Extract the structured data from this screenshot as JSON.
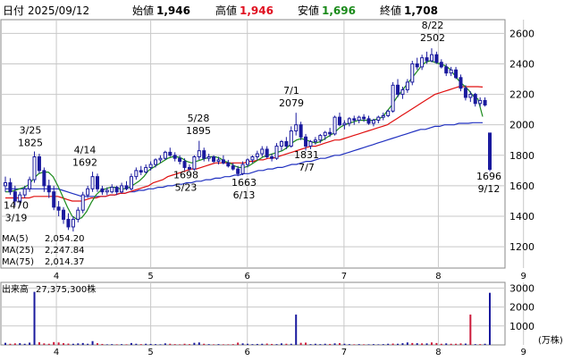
{
  "header": {
    "date_label": "日付",
    "date_value": "2025/09/12",
    "open_label": "始値",
    "open_value": "1,946",
    "high_label": "高値",
    "high_value": "1,946",
    "low_label": "安値",
    "low_value": "1,696",
    "close_label": "終値",
    "close_value": "1,708"
  },
  "colors": {
    "up_candle": "#1a1a9e",
    "ma5": "#1a8a1a",
    "ma25": "#e01010",
    "ma75": "#2030c0",
    "volume_up": "#1a1a9e",
    "volume_down": "#cc1a3a",
    "grid": "#c8c8c8",
    "label_red": "#e01020",
    "label_green": "#1a8a1a"
  },
  "chart_data": [
    {
      "type": "candlestick",
      "x_ticks": [
        "4",
        "5",
        "6",
        "7",
        "8",
        "9"
      ],
      "y_ticks": [
        "1200",
        "1400",
        "1600",
        "1800",
        "2000",
        "2200",
        "2400",
        "2600"
      ],
      "ylim": [
        1060,
        2690
      ],
      "grid": true,
      "legend": [
        {
          "name": "MA(5)",
          "value": "2,054.20"
        },
        {
          "name": "MA(25)",
          "value": "2,247.84"
        },
        {
          "name": "MA(75)",
          "value": "2,014.37"
        }
      ],
      "annotations": [
        {
          "date": "3/19",
          "value": "1470",
          "kind": "low"
        },
        {
          "date": "3/25",
          "value": "1825",
          "kind": "high"
        },
        {
          "date": "4/14",
          "value": "1692",
          "kind": "high"
        },
        {
          "date": "5/23",
          "value": "1698",
          "kind": "low"
        },
        {
          "date": "5/28",
          "value": "1895",
          "kind": "high"
        },
        {
          "date": "6/13",
          "value": "1663",
          "kind": "low"
        },
        {
          "date": "7/1",
          "value": "2079",
          "kind": "high"
        },
        {
          "date": "7/7",
          "value": "1831",
          "kind": "low"
        },
        {
          "date": "8/22",
          "value": "2502",
          "kind": "high"
        },
        {
          "date": "9/12",
          "value": "1696",
          "kind": "low"
        }
      ],
      "candles": [
        {
          "o": 1600,
          "h": 1660,
          "l": 1560,
          "c": 1620
        },
        {
          "o": 1620,
          "h": 1650,
          "l": 1540,
          "c": 1560
        },
        {
          "o": 1560,
          "h": 1600,
          "l": 1470,
          "c": 1500
        },
        {
          "o": 1500,
          "h": 1560,
          "l": 1470,
          "c": 1540
        },
        {
          "o": 1540,
          "h": 1600,
          "l": 1520,
          "c": 1580
        },
        {
          "o": 1580,
          "h": 1660,
          "l": 1560,
          "c": 1640
        },
        {
          "o": 1640,
          "h": 1825,
          "l": 1620,
          "c": 1790
        },
        {
          "o": 1790,
          "h": 1810,
          "l": 1680,
          "c": 1700
        },
        {
          "o": 1700,
          "h": 1720,
          "l": 1560,
          "c": 1600
        },
        {
          "o": 1600,
          "h": 1640,
          "l": 1520,
          "c": 1560
        },
        {
          "o": 1560,
          "h": 1600,
          "l": 1440,
          "c": 1460
        },
        {
          "o": 1460,
          "h": 1500,
          "l": 1400,
          "c": 1440
        },
        {
          "o": 1440,
          "h": 1460,
          "l": 1350,
          "c": 1380
        },
        {
          "o": 1380,
          "h": 1420,
          "l": 1310,
          "c": 1330
        },
        {
          "o": 1330,
          "h": 1400,
          "l": 1300,
          "c": 1380
        },
        {
          "o": 1380,
          "h": 1460,
          "l": 1360,
          "c": 1440
        },
        {
          "o": 1440,
          "h": 1560,
          "l": 1420,
          "c": 1540
        },
        {
          "o": 1540,
          "h": 1600,
          "l": 1520,
          "c": 1580
        },
        {
          "o": 1580,
          "h": 1692,
          "l": 1560,
          "c": 1660
        },
        {
          "o": 1660,
          "h": 1680,
          "l": 1560,
          "c": 1580
        },
        {
          "o": 1580,
          "h": 1600,
          "l": 1540,
          "c": 1560
        },
        {
          "o": 1560,
          "h": 1590,
          "l": 1540,
          "c": 1570
        },
        {
          "o": 1560,
          "h": 1610,
          "l": 1550,
          "c": 1590
        },
        {
          "o": 1590,
          "h": 1600,
          "l": 1540,
          "c": 1560
        },
        {
          "o": 1560,
          "h": 1620,
          "l": 1550,
          "c": 1600
        },
        {
          "o": 1600,
          "h": 1630,
          "l": 1570,
          "c": 1580
        },
        {
          "o": 1580,
          "h": 1680,
          "l": 1570,
          "c": 1660
        },
        {
          "o": 1660,
          "h": 1720,
          "l": 1640,
          "c": 1700
        },
        {
          "o": 1700,
          "h": 1730,
          "l": 1670,
          "c": 1690
        },
        {
          "o": 1690,
          "h": 1740,
          "l": 1680,
          "c": 1720
        },
        {
          "o": 1720,
          "h": 1760,
          "l": 1700,
          "c": 1740
        },
        {
          "o": 1740,
          "h": 1780,
          "l": 1720,
          "c": 1770
        },
        {
          "o": 1770,
          "h": 1800,
          "l": 1750,
          "c": 1780
        },
        {
          "o": 1780,
          "h": 1830,
          "l": 1770,
          "c": 1820
        },
        {
          "o": 1820,
          "h": 1850,
          "l": 1790,
          "c": 1800
        },
        {
          "o": 1800,
          "h": 1820,
          "l": 1760,
          "c": 1780
        },
        {
          "o": 1780,
          "h": 1800,
          "l": 1740,
          "c": 1760
        },
        {
          "o": 1760,
          "h": 1780,
          "l": 1700,
          "c": 1720
        },
        {
          "o": 1720,
          "h": 1740,
          "l": 1698,
          "c": 1710
        },
        {
          "o": 1710,
          "h": 1800,
          "l": 1700,
          "c": 1790
        },
        {
          "o": 1790,
          "h": 1895,
          "l": 1770,
          "c": 1830
        },
        {
          "o": 1830,
          "h": 1850,
          "l": 1760,
          "c": 1780
        },
        {
          "o": 1780,
          "h": 1810,
          "l": 1760,
          "c": 1790
        },
        {
          "o": 1790,
          "h": 1800,
          "l": 1750,
          "c": 1760
        },
        {
          "o": 1760,
          "h": 1790,
          "l": 1740,
          "c": 1770
        },
        {
          "o": 1770,
          "h": 1800,
          "l": 1740,
          "c": 1750
        },
        {
          "o": 1750,
          "h": 1770,
          "l": 1720,
          "c": 1730
        },
        {
          "o": 1730,
          "h": 1750,
          "l": 1700,
          "c": 1710
        },
        {
          "o": 1710,
          "h": 1730,
          "l": 1663,
          "c": 1680
        },
        {
          "o": 1680,
          "h": 1760,
          "l": 1670,
          "c": 1740
        },
        {
          "o": 1740,
          "h": 1780,
          "l": 1720,
          "c": 1770
        },
        {
          "o": 1770,
          "h": 1800,
          "l": 1750,
          "c": 1790
        },
        {
          "o": 1790,
          "h": 1830,
          "l": 1770,
          "c": 1810
        },
        {
          "o": 1810,
          "h": 1860,
          "l": 1790,
          "c": 1840
        },
        {
          "o": 1840,
          "h": 1860,
          "l": 1780,
          "c": 1790
        },
        {
          "o": 1790,
          "h": 1810,
          "l": 1760,
          "c": 1780
        },
        {
          "o": 1780,
          "h": 1880,
          "l": 1770,
          "c": 1860
        },
        {
          "o": 1860,
          "h": 1900,
          "l": 1830,
          "c": 1890
        },
        {
          "o": 1890,
          "h": 1920,
          "l": 1840,
          "c": 1860
        },
        {
          "o": 1860,
          "h": 1990,
          "l": 1850,
          "c": 1960
        },
        {
          "o": 1960,
          "h": 2079,
          "l": 1930,
          "c": 2000
        },
        {
          "o": 2000,
          "h": 2020,
          "l": 1900,
          "c": 1920
        },
        {
          "o": 1920,
          "h": 1940,
          "l": 1831,
          "c": 1860
        },
        {
          "o": 1860,
          "h": 1900,
          "l": 1840,
          "c": 1890
        },
        {
          "o": 1890,
          "h": 1920,
          "l": 1870,
          "c": 1900
        },
        {
          "o": 1900,
          "h": 1940,
          "l": 1880,
          "c": 1930
        },
        {
          "o": 1930,
          "h": 1960,
          "l": 1900,
          "c": 1950
        },
        {
          "o": 1950,
          "h": 1980,
          "l": 1920,
          "c": 1940
        },
        {
          "o": 1940,
          "h": 2060,
          "l": 1930,
          "c": 2050
        },
        {
          "o": 2050,
          "h": 2080,
          "l": 1990,
          "c": 2000
        },
        {
          "o": 2000,
          "h": 2030,
          "l": 1970,
          "c": 2010
        },
        {
          "o": 2010,
          "h": 2050,
          "l": 1990,
          "c": 2040
        },
        {
          "o": 2040,
          "h": 2060,
          "l": 2000,
          "c": 2030
        },
        {
          "o": 2030,
          "h": 2060,
          "l": 2010,
          "c": 2050
        },
        {
          "o": 2050,
          "h": 2070,
          "l": 2020,
          "c": 2040
        },
        {
          "o": 2040,
          "h": 2060,
          "l": 2000,
          "c": 2010
        },
        {
          "o": 2010,
          "h": 2040,
          "l": 1990,
          "c": 2030
        },
        {
          "o": 2030,
          "h": 2060,
          "l": 2010,
          "c": 2050
        },
        {
          "o": 2050,
          "h": 2080,
          "l": 2030,
          "c": 2060
        },
        {
          "o": 2060,
          "h": 2100,
          "l": 2050,
          "c": 2090
        },
        {
          "o": 2090,
          "h": 2280,
          "l": 2080,
          "c": 2260
        },
        {
          "o": 2260,
          "h": 2300,
          "l": 2180,
          "c": 2200
        },
        {
          "o": 2200,
          "h": 2250,
          "l": 2170,
          "c": 2230
        },
        {
          "o": 2230,
          "h": 2300,
          "l": 2210,
          "c": 2280
        },
        {
          "o": 2280,
          "h": 2420,
          "l": 2260,
          "c": 2400
        },
        {
          "o": 2400,
          "h": 2440,
          "l": 2360,
          "c": 2380
        },
        {
          "o": 2380,
          "h": 2460,
          "l": 2360,
          "c": 2440
        },
        {
          "o": 2440,
          "h": 2480,
          "l": 2400,
          "c": 2420
        },
        {
          "o": 2420,
          "h": 2502,
          "l": 2410,
          "c": 2460
        },
        {
          "o": 2460,
          "h": 2480,
          "l": 2400,
          "c": 2410
        },
        {
          "o": 2410,
          "h": 2430,
          "l": 2370,
          "c": 2380
        },
        {
          "o": 2380,
          "h": 2400,
          "l": 2320,
          "c": 2340
        },
        {
          "o": 2340,
          "h": 2380,
          "l": 2320,
          "c": 2360
        },
        {
          "o": 2360,
          "h": 2380,
          "l": 2300,
          "c": 2310
        },
        {
          "o": 2310,
          "h": 2330,
          "l": 2220,
          "c": 2240
        },
        {
          "o": 2240,
          "h": 2260,
          "l": 2160,
          "c": 2180
        },
        {
          "o": 2180,
          "h": 2220,
          "l": 2150,
          "c": 2200
        },
        {
          "o": 2200,
          "h": 2210,
          "l": 2120,
          "c": 2140
        },
        {
          "o": 2140,
          "h": 2180,
          "l": 2120,
          "c": 2160
        },
        {
          "o": 2160,
          "h": 2180,
          "l": 2120,
          "c": 2130
        },
        {
          "o": 1946,
          "h": 1946,
          "l": 1696,
          "c": 1708
        }
      ],
      "ma5": [
        1560,
        1560,
        1570,
        1580,
        1590,
        1610,
        1650,
        1680,
        1690,
        1690,
        1660,
        1600,
        1530,
        1460,
        1400,
        1380,
        1390,
        1430,
        1490,
        1540,
        1570,
        1580,
        1590,
        1590,
        1580,
        1580,
        1590,
        1610,
        1630,
        1660,
        1700,
        1720,
        1740,
        1760,
        1780,
        1790,
        1790,
        1780,
        1760,
        1750,
        1760,
        1770,
        1780,
        1790,
        1790,
        1780,
        1760,
        1750,
        1730,
        1720,
        1720,
        1730,
        1750,
        1770,
        1790,
        1800,
        1810,
        1820,
        1830,
        1850,
        1880,
        1900,
        1910,
        1900,
        1890,
        1880,
        1890,
        1910,
        1930,
        1950,
        1980,
        2000,
        2010,
        2020,
        2030,
        2030,
        2030,
        2030,
        2040,
        2050,
        2090,
        2130,
        2180,
        2220,
        2260,
        2300,
        2340,
        2380,
        2410,
        2420,
        2410,
        2400,
        2390,
        2370,
        2330,
        2290,
        2260,
        2230,
        2190,
        2170,
        2054
      ],
      "ma25": [
        1520,
        1520,
        1520,
        1520,
        1520,
        1520,
        1530,
        1530,
        1530,
        1530,
        1530,
        1530,
        1520,
        1510,
        1500,
        1500,
        1500,
        1510,
        1520,
        1520,
        1530,
        1530,
        1540,
        1540,
        1550,
        1550,
        1560,
        1570,
        1580,
        1590,
        1600,
        1620,
        1630,
        1640,
        1660,
        1670,
        1680,
        1690,
        1700,
        1710,
        1710,
        1720,
        1730,
        1740,
        1750,
        1750,
        1750,
        1750,
        1750,
        1750,
        1750,
        1760,
        1760,
        1770,
        1770,
        1780,
        1780,
        1790,
        1800,
        1810,
        1820,
        1830,
        1840,
        1850,
        1860,
        1860,
        1870,
        1880,
        1890,
        1900,
        1900,
        1910,
        1920,
        1930,
        1940,
        1950,
        1960,
        1970,
        1980,
        1990,
        2000,
        2020,
        2040,
        2060,
        2080,
        2100,
        2120,
        2140,
        2160,
        2180,
        2200,
        2210,
        2220,
        2230,
        2240,
        2250,
        2250,
        2250,
        2250,
        2250,
        2248
      ],
      "ma75": [
        1580,
        1580,
        1580,
        1580,
        1580,
        1580,
        1580,
        1580,
        1580,
        1580,
        1580,
        1580,
        1570,
        1560,
        1550,
        1540,
        1530,
        1530,
        1530,
        1530,
        1530,
        1530,
        1540,
        1540,
        1550,
        1550,
        1560,
        1560,
        1570,
        1570,
        1580,
        1580,
        1590,
        1590,
        1600,
        1600,
        1610,
        1610,
        1620,
        1620,
        1630,
        1630,
        1640,
        1640,
        1650,
        1650,
        1660,
        1660,
        1670,
        1670,
        1680,
        1680,
        1690,
        1700,
        1700,
        1710,
        1710,
        1720,
        1720,
        1730,
        1740,
        1740,
        1750,
        1760,
        1760,
        1770,
        1780,
        1780,
        1790,
        1800,
        1800,
        1810,
        1820,
        1830,
        1840,
        1850,
        1860,
        1870,
        1880,
        1890,
        1900,
        1910,
        1920,
        1930,
        1940,
        1950,
        1960,
        1970,
        1970,
        1980,
        1990,
        1990,
        2000,
        2000,
        2000,
        2010,
        2010,
        2010,
        2014,
        2014,
        2014
      ]
    },
    {
      "type": "bar",
      "title": "出来高",
      "title_value": "27,375,300株",
      "y_ticks": [
        "1000",
        "2000",
        "3000"
      ],
      "y_unit": "(万株)",
      "ylim": [
        0,
        3300
      ],
      "x_ticks": [
        "4",
        "5",
        "6",
        "7",
        "8",
        "9"
      ],
      "values": [
        110,
        60,
        80,
        90,
        60,
        120,
        2800,
        140,
        80,
        60,
        150,
        130,
        90,
        70,
        60,
        80,
        100,
        60,
        200,
        90,
        50,
        30,
        40,
        30,
        40,
        30,
        100,
        60,
        40,
        60,
        50,
        40,
        30,
        80,
        60,
        40,
        30,
        60,
        40,
        110,
        130,
        60,
        40,
        30,
        40,
        30,
        30,
        40,
        120,
        80,
        60,
        40,
        50,
        60,
        70,
        50,
        40,
        80,
        60,
        60,
        1600,
        110,
        120,
        40,
        60,
        40,
        60,
        50,
        80,
        90,
        60,
        40,
        30,
        40,
        30,
        30,
        40,
        30,
        40,
        60,
        70,
        60,
        90,
        130,
        100,
        90,
        80,
        80,
        130,
        100,
        60,
        80,
        60,
        60,
        80,
        70,
        1600,
        40,
        40,
        60,
        2750
      ],
      "up": [
        1,
        0,
        0,
        1,
        1,
        1,
        1,
        0,
        0,
        0,
        0,
        0,
        0,
        0,
        1,
        1,
        1,
        1,
        1,
        0,
        0,
        1,
        1,
        0,
        1,
        0,
        1,
        1,
        0,
        1,
        1,
        1,
        1,
        1,
        0,
        0,
        0,
        0,
        0,
        1,
        1,
        0,
        1,
        0,
        1,
        0,
        0,
        0,
        0,
        1,
        1,
        1,
        1,
        1,
        0,
        0,
        1,
        1,
        0,
        1,
        1,
        0,
        0,
        1,
        1,
        1,
        1,
        0,
        1,
        0,
        1,
        1,
        0,
        1,
        0,
        1,
        1,
        1,
        1,
        1,
        0,
        1,
        1,
        1,
        0,
        1,
        0,
        1,
        0,
        0,
        0,
        1,
        0,
        0,
        0,
        1,
        0,
        1,
        0,
        1,
        1
      ]
    }
  ]
}
